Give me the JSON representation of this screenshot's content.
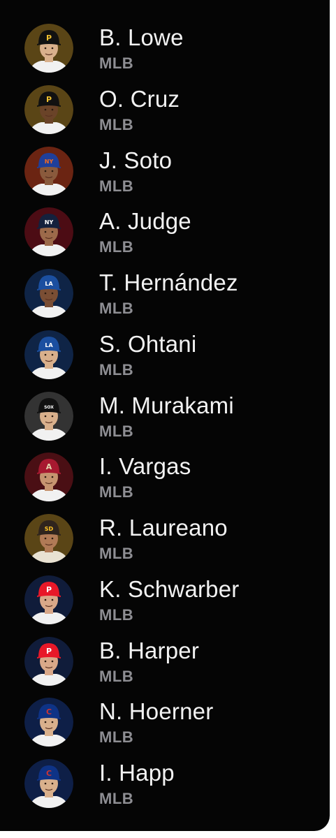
{
  "players": [
    {
      "name": "B. Lowe",
      "league": "MLB",
      "team_icon": "pirates-cap-icon",
      "bg": "#5a4516",
      "cap": "#111111",
      "logo": "P",
      "logo_color": "#f2c230",
      "skin": "#d9b08c",
      "jersey": "#f1f1f1"
    },
    {
      "name": "O. Cruz",
      "league": "MLB",
      "team_icon": "pirates-cap-icon",
      "bg": "#5a4516",
      "cap": "#111111",
      "logo": "P",
      "logo_color": "#f2c230",
      "skin": "#6a4328",
      "jersey": "#f1f1f1"
    },
    {
      "name": "J. Soto",
      "league": "MLB",
      "team_icon": "mets-cap-icon",
      "bg": "#6b2412",
      "cap": "#1f3f9a",
      "logo": "NY",
      "logo_color": "#f26a22",
      "skin": "#8a5a3c",
      "jersey": "#f1f1f1"
    },
    {
      "name": "A. Judge",
      "league": "MLB",
      "team_icon": "yankees-cap-icon",
      "bg": "#4c0c14",
      "cap": "#14213d",
      "logo": "NY",
      "logo_color": "#ffffff",
      "skin": "#9c6a4a",
      "jersey": "#f1f1f1"
    },
    {
      "name": "T. Hernández",
      "league": "MLB",
      "team_icon": "dodgers-cap-icon",
      "bg": "#0f2446",
      "cap": "#1b4fa0",
      "logo": "LA",
      "logo_color": "#ffffff",
      "skin": "#7a4e34",
      "jersey": "#f1f1f1"
    },
    {
      "name": "S. Ohtani",
      "league": "MLB",
      "team_icon": "dodgers-cap-icon",
      "bg": "#0f2446",
      "cap": "#1b4fa0",
      "logo": "LA",
      "logo_color": "#ffffff",
      "skin": "#d9b08c",
      "jersey": "#f1f1f1"
    },
    {
      "name": "M. Murakami",
      "league": "MLB",
      "team_icon": "white-sox-cap-icon",
      "bg": "#333333",
      "cap": "#111111",
      "logo": "SOX",
      "logo_color": "#ffffff",
      "skin": "#d9b08c",
      "jersey": "#f1f1f1"
    },
    {
      "name": "I. Vargas",
      "league": "MLB",
      "team_icon": "diamondbacks-cap-icon",
      "bg": "#4a0f14",
      "cap": "#a71930",
      "logo": "A",
      "logo_color": "#e3d4ad",
      "skin": "#c69470",
      "jersey": "#f1f1f1"
    },
    {
      "name": "R. Laureano",
      "league": "MLB",
      "team_icon": "padres-cap-icon",
      "bg": "#5a4516",
      "cap": "#2f241d",
      "logo": "SD",
      "logo_color": "#ffc425",
      "skin": "#b07a56",
      "jersey": "#e9e2d2"
    },
    {
      "name": "K. Schwarber",
      "league": "MLB",
      "team_icon": "phillies-cap-icon",
      "bg": "#101c3a",
      "cap": "#e81828",
      "logo": "P",
      "logo_color": "#ffffff",
      "skin": "#d9a889",
      "jersey": "#f1f1f1"
    },
    {
      "name": "B. Harper",
      "league": "MLB",
      "team_icon": "phillies-cap-icon",
      "bg": "#101c3a",
      "cap": "#e81828",
      "logo": "P",
      "logo_color": "#ffffff",
      "skin": "#d9a889",
      "jersey": "#f1f1f1"
    },
    {
      "name": "N. Hoerner",
      "league": "MLB",
      "team_icon": "cubs-cap-icon",
      "bg": "#0e1f47",
      "cap": "#0e3386",
      "logo": "C",
      "logo_color": "#cc3433",
      "skin": "#d9b08c",
      "jersey": "#f1f1f1"
    },
    {
      "name": "I. Happ",
      "league": "MLB",
      "team_icon": "cubs-cap-icon",
      "bg": "#0e1f47",
      "cap": "#0e3386",
      "logo": "C",
      "logo_color": "#cc3433",
      "skin": "#d9b08c",
      "jersey": "#f1f1f1"
    }
  ]
}
